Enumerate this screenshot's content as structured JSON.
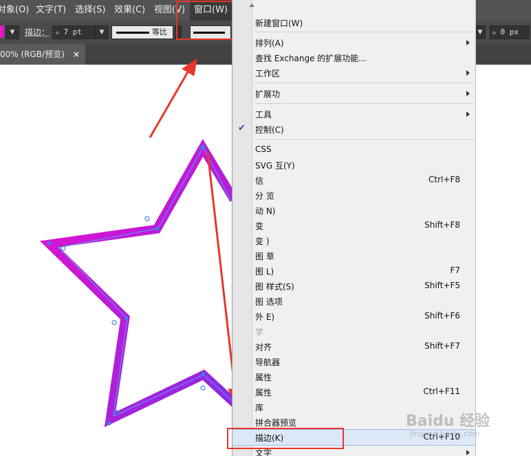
{
  "menubar": {
    "items": [
      {
        "label": "对象(O)"
      },
      {
        "label": "文字(T)"
      },
      {
        "label": "选择(S)"
      },
      {
        "label": "效果(C)"
      },
      {
        "label": "视图(V)"
      },
      {
        "label": "窗口(W)"
      }
    ]
  },
  "toolbar": {
    "stroke_label": "描边：",
    "stroke_weight": "7 pt",
    "profile_label": "等比",
    "right_value": "0 px"
  },
  "document_tab": {
    "title": "00% (RGB/预览)",
    "close": "×"
  },
  "menu": {
    "items": [
      {
        "label": "新建窗口(W)"
      },
      {
        "label": "排列(A)",
        "submenu": true
      },
      {
        "label": "查找 Exchange 的扩展功能..."
      },
      {
        "label": "工作区",
        "submenu": true
      },
      {
        "label": "扩展功",
        "submenu": true
      },
      {
        "label": "工具",
        "submenu": true
      },
      {
        "label": "控制(C)",
        "checked": true
      },
      {
        "label": "CSS"
      },
      {
        "label": "SVG 互(Y)"
      },
      {
        "label": "信",
        "shortcut": "Ctrl+F8"
      },
      {
        "label": "分 览"
      },
      {
        "label": "动 N)"
      },
      {
        "label": "变",
        "shortcut": "Shift+F8"
      },
      {
        "label": "变 )"
      },
      {
        "label": "图 草"
      },
      {
        "label": "图 L)",
        "shortcut": "F7"
      },
      {
        "label": "图 样式(S)",
        "shortcut": "Shift+F5"
      },
      {
        "label": "图 选项"
      },
      {
        "label": "外 E)",
        "shortcut": "Shift+F6"
      },
      {
        "label": "学"
      },
      {
        "label": "对齐",
        "shortcut": "Shift+F7"
      },
      {
        "label": "导航器"
      },
      {
        "label": "属性"
      },
      {
        "label": "属性",
        "shortcut": "Ctrl+F11"
      },
      {
        "label": "库"
      },
      {
        "label": "拼合器预览"
      },
      {
        "label": "描边(K)",
        "shortcut": "Ctrl+F10",
        "highlighted": true
      },
      {
        "label": "文字",
        "submenu": true
      }
    ]
  },
  "watermark": {
    "text": "Baidu 经验",
    "subtext": "jingyan.baidu.com"
  },
  "colors": {
    "menubar_bg": "#535353",
    "toolbar_bg": "#4a4a4a",
    "menu_bg": "#f0f0f0",
    "annotation_red": "#e8362a",
    "star_gradient_start": "#e60fcf",
    "star_gradient_end": "#8a2be2"
  },
  "icons": [
    "check-icon",
    "submenu-arrow-icon",
    "scroll-up-icon",
    "close-icon",
    "dropdown-chevron-icon"
  ]
}
